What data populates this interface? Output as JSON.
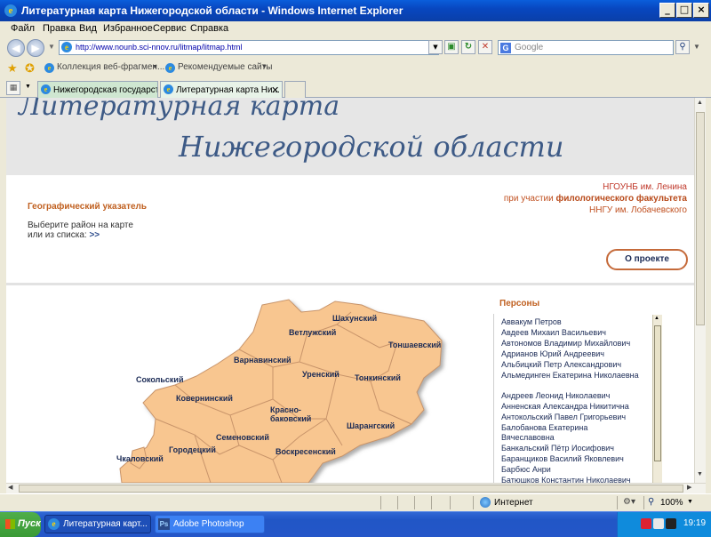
{
  "window": {
    "title": "Литературная карта Нижегородской области - Windows Internet Explorer",
    "controls": [
      "_",
      "□",
      "×"
    ]
  },
  "menu": [
    "Файл",
    "Правка",
    "Вид",
    "Избранное",
    "Сервис",
    "Справка"
  ],
  "address": {
    "url": "http://www.nounb.sci-nnov.ru/litmap/litmap.html",
    "search_placeholder": "Google"
  },
  "favorites": {
    "items": [
      "Коллекция веб-фрагмен...",
      "Рекомендуемые сайты"
    ]
  },
  "tabs": [
    {
      "label": "Нижегородская государств...",
      "active": false
    },
    {
      "label": "Литературная карта Ни...",
      "active": true
    }
  ],
  "page": {
    "banner": {
      "line1": "Литературная карта",
      "line2": "Нижегородской области"
    },
    "org": {
      "line1_prefix": "НГОУНБ",
      "line1_suffix": "им. Ленина",
      "line2_prefix": "при участии",
      "line2_suffix": "филологического факультета",
      "line3": "ННГУ им. Лобачевского"
    },
    "geo_index": "Географический указатель",
    "choose_line1": "Выберите район на карте",
    "choose_line2": "или из списка:",
    "choose_arrow": ">>",
    "about_button": "О проекте",
    "map_labels": [
      "Шахунский",
      "Ветлужский",
      "Тоншаевский",
      "Варнавинский",
      "Уренский",
      "Сокольский",
      "Тонкинский",
      "Ковернинский",
      "Красно-баковский",
      "Шарангский",
      "Семеновский",
      "Городецкий",
      "Воскресенский",
      "Чкаловский"
    ],
    "persons_title": "Персоны",
    "persons": [
      "Аввакум Петров",
      "Авдеев Михаил Васильевич",
      "Автономов Владимир Михайлович",
      "Адрианов Юрий Андреевич",
      "Альбицкий Петр Александрович",
      "Альмединген Екатерина Николаевна",
      "Андреев Леонид Николаевич",
      "Анненская Александра Никитична",
      "Антокольский Павел Григорьевич",
      "Балобанова Екатерина Вячеславовна",
      "Банкальский Пётр Иосифович",
      "Баранщиков Василий Яковлевич",
      "Барбюс Анри",
      "Батюшков Константин Николаевич"
    ]
  },
  "status": {
    "zone": "Интернет",
    "zoom": "100%"
  },
  "taskbar": {
    "start": "Пуск",
    "tasks": [
      "Литературная карт...",
      "Adobe Photoshop"
    ],
    "lang": "EN",
    "time": "19:19"
  }
}
